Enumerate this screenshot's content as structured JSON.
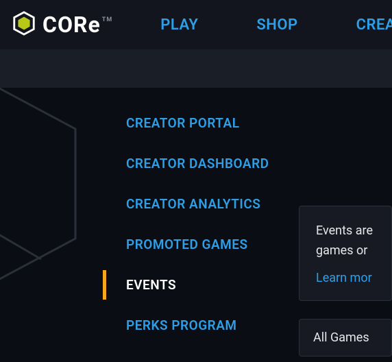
{
  "header": {
    "logo_text": "CORe",
    "tm": "TM",
    "nav": [
      {
        "label": "PLAY"
      },
      {
        "label": "SHOP"
      },
      {
        "label": "CREATE"
      }
    ]
  },
  "sidebar": {
    "items": [
      {
        "label": "CREATOR PORTAL",
        "active": false
      },
      {
        "label": "CREATOR DASHBOARD",
        "active": false
      },
      {
        "label": "CREATOR ANALYTICS",
        "active": false
      },
      {
        "label": "PROMOTED GAMES",
        "active": false
      },
      {
        "label": "EVENTS",
        "active": true
      },
      {
        "label": "PERKS PROGRAM",
        "active": false
      }
    ]
  },
  "content": {
    "info_line1": "Events are",
    "info_line2": "games or",
    "learn_more": "Learn mor",
    "dropdown_value": "All Games"
  }
}
